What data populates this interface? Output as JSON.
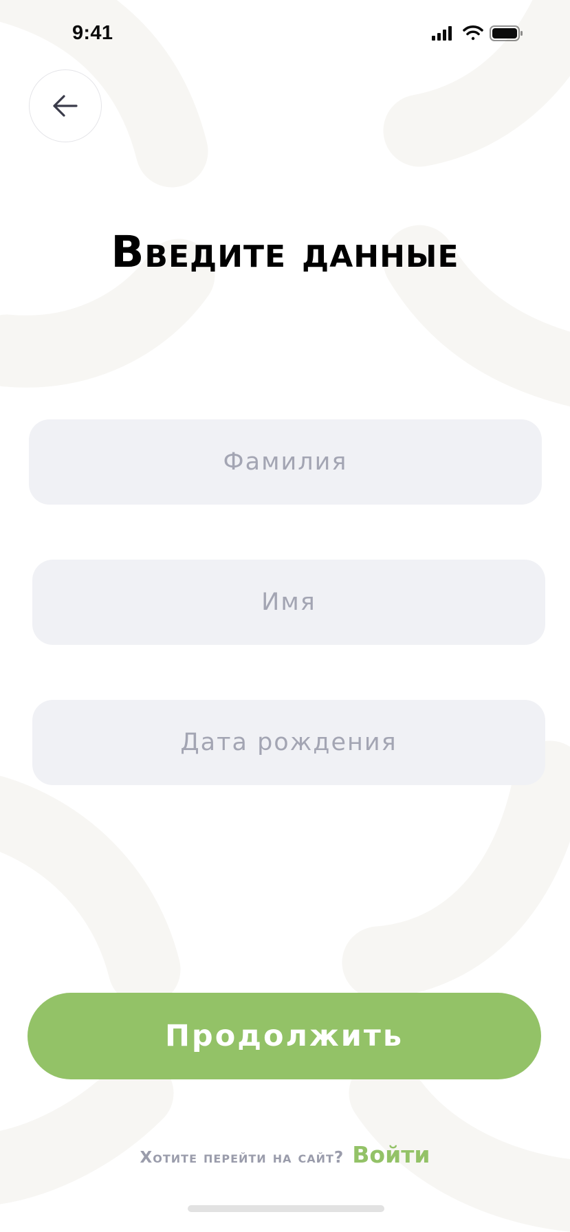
{
  "status_bar": {
    "time": "9:41",
    "icons": [
      "cellular-signal-icon",
      "wifi-icon",
      "battery-icon"
    ]
  },
  "header": {
    "back_icon": "arrow-left-icon"
  },
  "main": {
    "title": "Введите данные",
    "fields": [
      {
        "placeholder": "Фамилия",
        "value": ""
      },
      {
        "placeholder": "Имя",
        "value": ""
      },
      {
        "placeholder": "Дата рождения",
        "value": ""
      }
    ],
    "continue_label": "Продолжить"
  },
  "footer": {
    "question": "Хотите перейти на сайт?",
    "login_link": "Войти"
  },
  "colors": {
    "accent": "#93c267",
    "field_bg": "#f0f1f5",
    "placeholder": "#a3a5b3",
    "decor": "#f7f6f3"
  }
}
